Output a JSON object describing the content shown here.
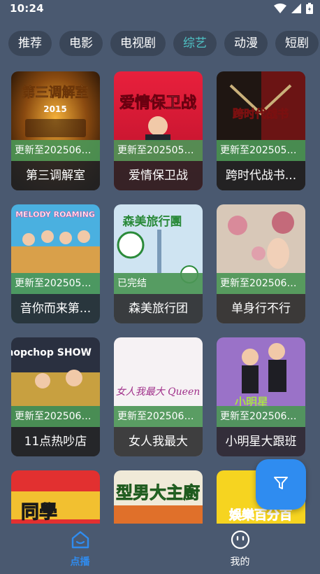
{
  "status_bar": {
    "time": "10:24"
  },
  "tabs": [
    {
      "label": "推荐",
      "active": false
    },
    {
      "label": "电影",
      "active": false
    },
    {
      "label": "电视剧",
      "active": false
    },
    {
      "label": "综艺",
      "active": true
    },
    {
      "label": "动漫",
      "active": false
    },
    {
      "label": "短剧",
      "active": false
    }
  ],
  "cards": [
    {
      "status": "更新至2025060...",
      "title": "第三调解室",
      "poster_text": "第三调解室",
      "poster_sub": "2015"
    },
    {
      "status": "更新至2025052...",
      "title": "爱情保卫战",
      "poster_text": "爱情保卫战",
      "poster_sub": ""
    },
    {
      "status": "更新至2025052...",
      "title": "跨时代战书...",
      "poster_text": "跨时代战书",
      "poster_sub": ""
    },
    {
      "status": "更新至2025052...",
      "title": "音你而来第...",
      "poster_text": "MELODY ROAMING",
      "poster_sub": ""
    },
    {
      "status": "已完结",
      "title": "森美旅行团",
      "poster_text": "森美旅行團",
      "poster_sub": ""
    },
    {
      "status": "更新至2025060...",
      "title": "单身行不行",
      "poster_text": "",
      "poster_sub": ""
    },
    {
      "status": "更新至2025060...",
      "title": "11点热吵店",
      "poster_text": "chopchop SHOW",
      "poster_sub": ""
    },
    {
      "status": "更新至2025060...",
      "title": "女人我最大",
      "poster_text": "女人我最大 Queen",
      "poster_sub": ""
    },
    {
      "status": "更新至2025060...",
      "title": "小明星大跟班",
      "poster_text": "小明星",
      "poster_sub": ""
    },
    {
      "status": "",
      "title": "",
      "poster_text": "同學",
      "poster_sub": ""
    },
    {
      "status": "",
      "title": "",
      "poster_text": "型男大主廚",
      "poster_sub": ""
    },
    {
      "status": "",
      "title": "",
      "poster_text": "娛樂百分百",
      "poster_sub": ""
    }
  ],
  "fab": {
    "icon": "filter-icon"
  },
  "bottom_nav": [
    {
      "label": "点播",
      "icon": "home-icon",
      "active": true
    },
    {
      "label": "我的",
      "icon": "profile-icon",
      "active": false
    }
  ],
  "colors": {
    "background": "#4a5970",
    "tab_background": "#3a4658",
    "active_tab": "#4fc3c6",
    "status_strip": "#4c9656",
    "accent": "#2f8cf0"
  }
}
